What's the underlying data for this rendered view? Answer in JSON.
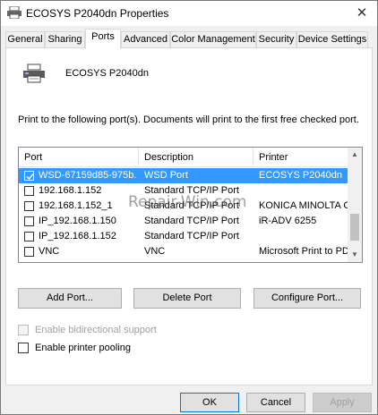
{
  "window": {
    "title": "ECOSYS P2040dn Properties",
    "close_glyph": "✕"
  },
  "tabs": [
    {
      "label": "General"
    },
    {
      "label": "Sharing"
    },
    {
      "label": "Ports"
    },
    {
      "label": "Advanced"
    },
    {
      "label": "Color Management"
    },
    {
      "label": "Security"
    },
    {
      "label": "Device Settings"
    }
  ],
  "active_tab": "Ports",
  "printer": {
    "name": "ECOSYS P2040dn",
    "icon": "printer-icon"
  },
  "instructions": "Print to the following port(s). Documents will print to the first free checked port.",
  "ports_list": {
    "columns": [
      "Port",
      "Description",
      "Printer"
    ],
    "rows": [
      {
        "port": "WSD-67159d85-975b...",
        "description": "WSD Port",
        "printer": "ECOSYS P2040dn",
        "checked": true,
        "selected": true
      },
      {
        "port": "192.168.1.152",
        "description": "Standard TCP/IP Port",
        "printer": "",
        "checked": false,
        "selected": false
      },
      {
        "port": "192.168.1.152_1",
        "description": "Standard TCP/IP Port",
        "printer": "KONICA MINOLTA C...",
        "checked": false,
        "selected": false
      },
      {
        "port": "IP_192.168.1.150",
        "description": "Standard TCP/IP Port",
        "printer": "iR-ADV 6255",
        "checked": false,
        "selected": false
      },
      {
        "port": "IP_192.168.1.152",
        "description": "Standard TCP/IP Port",
        "printer": "",
        "checked": false,
        "selected": false
      },
      {
        "port": "VNC",
        "description": "VNC",
        "printer": "Microsoft Print to PDF",
        "checked": false,
        "selected": false
      }
    ]
  },
  "buttons": {
    "add_port": "Add Port...",
    "delete_port": "Delete Port",
    "configure_port": "Configure Port..."
  },
  "options": {
    "bidirectional": {
      "label": "Enable bidirectional support",
      "checked": false,
      "enabled": false
    },
    "pooling": {
      "label": "Enable printer pooling",
      "checked": false,
      "enabled": true
    }
  },
  "footer": {
    "ok": "OK",
    "cancel": "Cancel",
    "apply": "Apply"
  },
  "watermark": "Repair-Win.com",
  "colors": {
    "selection": "#3399ff",
    "default_button_border": "#0078d7"
  }
}
